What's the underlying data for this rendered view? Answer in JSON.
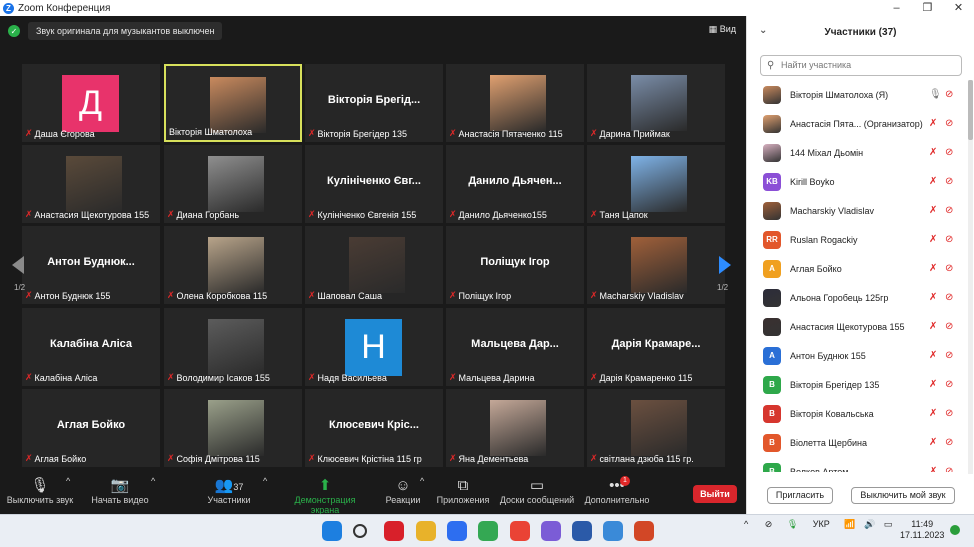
{
  "window": {
    "title": "Zoom Конференция",
    "buttons": [
      "–",
      "❐",
      "✕"
    ]
  },
  "notice": "Звук оригинала для музыкантов выключен",
  "view_label": "Вид",
  "grid_tiles": [
    {
      "label": "Даша Єгорова",
      "type": "avatar",
      "letter": "Д",
      "color": "#e8336b"
    },
    {
      "label": "Вікторія Шматолоха",
      "type": "photo",
      "color": "#c98a5e",
      "active": true
    },
    {
      "label": "Вікторія Брегідер 135",
      "type": "name",
      "bigname": "Вікторія Брегід..."
    },
    {
      "label": "Анастасія Пятаченко 115",
      "type": "photo",
      "color": "#e0a070"
    },
    {
      "label": "Дарина Приймак",
      "type": "photo",
      "color": "#7a8da8"
    },
    {
      "label": "Анастасия Щекотурова 155",
      "type": "photo",
      "color": "#5a4a3a"
    },
    {
      "label": "Диана Горбань",
      "type": "photo",
      "color": "#8f8f8f"
    },
    {
      "label": "Кулініченко Євгенія 155",
      "type": "name",
      "bigname": "Кулініченко Євг..."
    },
    {
      "label": "Данило Дьяченко155",
      "type": "name",
      "bigname": "Данило Дьячен..."
    },
    {
      "label": "Таня Цапок",
      "type": "photo",
      "color": "#7fb3e8"
    },
    {
      "label": "Антон Буднюк 155",
      "type": "name",
      "bigname": "Антон Буднюк..."
    },
    {
      "label": "Олена Коробкова 115",
      "type": "photo",
      "color": "#b8a48a"
    },
    {
      "label": "Шаповал Саша",
      "type": "photo",
      "color": "#4a3c34"
    },
    {
      "label": "Поліщук Ігор",
      "type": "name",
      "bigname": "Поліщук Ігор"
    },
    {
      "label": "Macharskiy Vladislav",
      "type": "photo",
      "color": "#a0603a"
    },
    {
      "label": "Калабіна Аліса",
      "type": "name",
      "bigname": "Калабіна Аліса"
    },
    {
      "label": "Володимир Ісаков 155",
      "type": "photo",
      "color": "#5c5c5c"
    },
    {
      "label": "Надя Васильева",
      "type": "avatar",
      "letter": "H",
      "color": "#1e8ad6"
    },
    {
      "label": "Мальцева Дарина",
      "type": "name",
      "bigname": "Мальцева Дар..."
    },
    {
      "label": "Дарія Крамаренко 115",
      "type": "name",
      "bigname": "Дарія Крамаре..."
    },
    {
      "label": "Аглая Бойко",
      "type": "name",
      "bigname": "Аглая Бойко"
    },
    {
      "label": "Софія Дмітрова 115",
      "type": "photo",
      "color": "#9aa08a"
    },
    {
      "label": "Клюсевич Крістіна 115 гр",
      "type": "name",
      "bigname": "Клюсевич Кріс..."
    },
    {
      "label": "Яна Дементьева",
      "type": "photo",
      "color": "#c4a898"
    },
    {
      "label": "світлана дзюба 115 гр.",
      "type": "photo",
      "color": "#6b5040"
    }
  ],
  "pager": {
    "left": "1/2",
    "right": "1/2"
  },
  "toolbar": {
    "mute": "Выключить звук",
    "video": "Начать видео",
    "participants": "Участники",
    "participants_count": "37",
    "share": "Демонстрация экрана",
    "reactions": "Реакции",
    "apps": "Приложения",
    "whiteboards": "Доски сообщений",
    "more": "Дополнительно",
    "more_badge": "1",
    "leave": "Выйти"
  },
  "panel": {
    "title": "Участники (37)",
    "search_placeholder": "Найти участника",
    "participants": [
      {
        "name": "Вікторія Шматолоха (Я)",
        "avatar": "photo",
        "color": "#c98a5e",
        "mic_on": true
      },
      {
        "name": "Анастасія Пята... (Организатор)",
        "avatar": "photo",
        "color": "#e0a070"
      },
      {
        "name": "144 Міхал Дьомін",
        "avatar": "photo",
        "color": "#d7b0c0"
      },
      {
        "name": "Kirill Boyko",
        "avatar": "KB",
        "color": "#8b4fd6"
      },
      {
        "name": "Macharskiy Vladislav",
        "avatar": "photo",
        "color": "#a0603a"
      },
      {
        "name": "Ruslan Rogackiy",
        "avatar": "RR",
        "color": "#e2572b"
      },
      {
        "name": "Аглая Бойко",
        "avatar": "А",
        "color": "#f0a020"
      },
      {
        "name": "Альона Горобець 125гр",
        "avatar": "photo",
        "color": "#2c2c3a"
      },
      {
        "name": "Анастасия Щекотурова 155",
        "avatar": "photo",
        "color": "#3a3030"
      },
      {
        "name": "Антон Буднюк 155",
        "avatar": "А",
        "color": "#2a6fd6"
      },
      {
        "name": "Вікторія Брегідер 135",
        "avatar": "В",
        "color": "#2ea84a"
      },
      {
        "name": "Вікторія Ковальська",
        "avatar": "В",
        "color": "#d6362e"
      },
      {
        "name": "Віолетта Щербина",
        "avatar": "В",
        "color": "#e2572b"
      },
      {
        "name": "Волков Артем",
        "avatar": "В",
        "color": "#2ea84a"
      }
    ],
    "invite": "Пригласить",
    "mute_me": "Выключить мой звук"
  },
  "taskbar": {
    "lang": "УКР",
    "time": "11:49",
    "date": "17.11.2023",
    "apps": [
      {
        "name": "windows-start-icon",
        "color": "#1d7fe0"
      },
      {
        "name": "search-icon",
        "color": "#333333"
      },
      {
        "name": "opera-icon",
        "color": "#d8202a"
      },
      {
        "name": "chrome-icon",
        "color": "#e8b22a"
      },
      {
        "name": "zoom-icon",
        "color": "#2d6ef0"
      },
      {
        "name": "chrome-icon-2",
        "color": "#34a853"
      },
      {
        "name": "chrome-icon-3",
        "color": "#ea4335"
      },
      {
        "name": "viber-icon",
        "color": "#7b5cd6"
      },
      {
        "name": "word-icon",
        "color": "#2b5aa8"
      },
      {
        "name": "notepad-icon",
        "color": "#3a8ad8"
      },
      {
        "name": "powerpoint-icon",
        "color": "#d24726"
      }
    ]
  }
}
